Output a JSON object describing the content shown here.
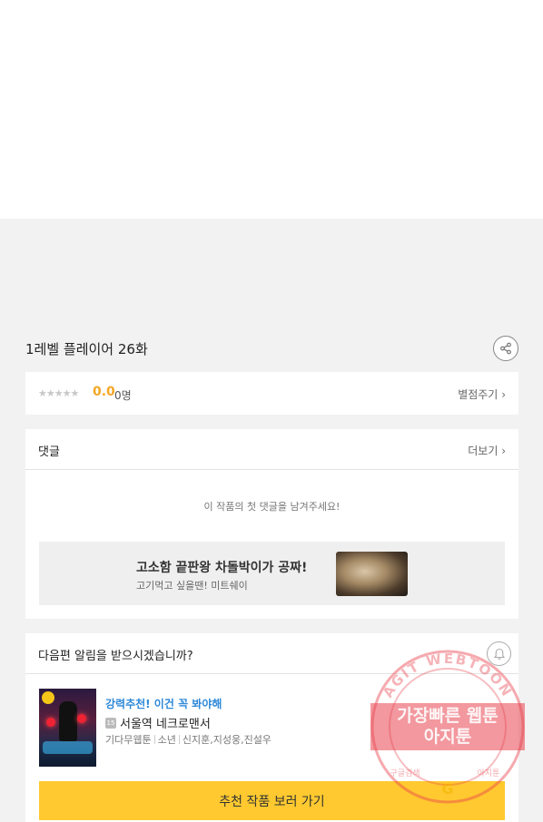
{
  "episode": {
    "title": "1레벨 플레이어 26화"
  },
  "rating": {
    "stars": "★★★★★",
    "score": "0.0",
    "voters": "0명",
    "rate_link": "별점주기"
  },
  "comments": {
    "title": "댓글",
    "more_link": "더보기",
    "empty_message": "이 작품의 첫 댓글을 남겨주세요!",
    "ad": {
      "title": "고소함 끝판왕 차돌박이가 공짜!",
      "subtitle": "고기먹고 싶을땐! 미트쉐이"
    }
  },
  "notify": {
    "question": "다음편 알림을 받으시겠습니까?",
    "recommendation": {
      "promo": "강력추천! 이건 꼭 봐야해",
      "age_badge": "15",
      "title": "서울역 네크로맨서",
      "meta": [
        "기다무웹툰",
        "소년",
        "신지훈,지성웅,진설우"
      ]
    },
    "cta_label": "추천 작품 보러 가기"
  },
  "watermark": {
    "top_text": "AGIT WEBTOON",
    "line1": "가장빠른 웹툰",
    "line2": "아지툰",
    "bottom_left": "구글검색",
    "bottom_right": "아지툰"
  },
  "colors": {
    "accent": "#ffc92f",
    "score": "#f5a623",
    "promo": "#2d88d8",
    "watermark": "#e8434e"
  }
}
